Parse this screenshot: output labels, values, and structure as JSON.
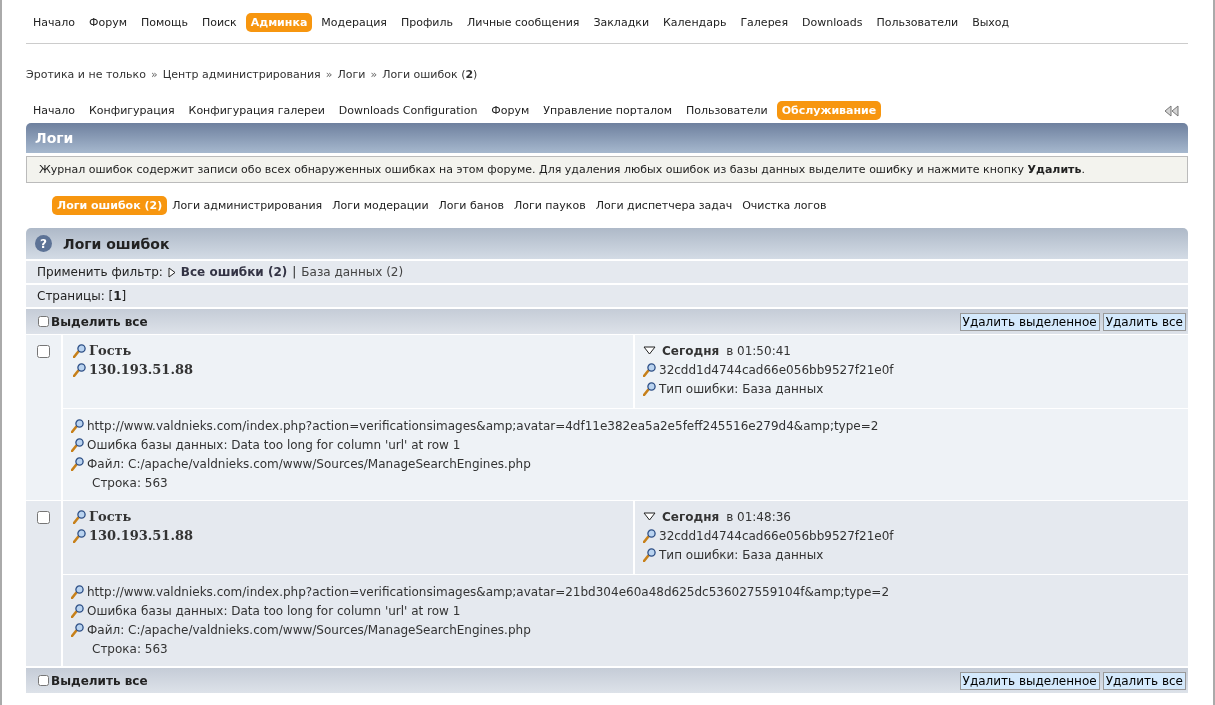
{
  "main_menu": [
    {
      "label": "Начало",
      "selected": false
    },
    {
      "label": "Форум",
      "selected": false
    },
    {
      "label": "Помощь",
      "selected": false
    },
    {
      "label": "Поиск",
      "selected": false
    },
    {
      "label": "Админка",
      "selected": true
    },
    {
      "label": "Модерация",
      "selected": false
    },
    {
      "label": "Профиль",
      "selected": false
    },
    {
      "label": "Личные сообщения",
      "selected": false
    },
    {
      "label": "Закладки",
      "selected": false
    },
    {
      "label": "Календарь",
      "selected": false
    },
    {
      "label": "Галерея",
      "selected": false
    },
    {
      "label": "Downloads",
      "selected": false
    },
    {
      "label": "Пользователи",
      "selected": false
    },
    {
      "label": "Выход",
      "selected": false
    }
  ],
  "breadcrumb": [
    "Эротика и не только",
    "Центр администрирования",
    "Логи",
    "Логи ошибок (**2**)"
  ],
  "breadcrumb_separator": "»",
  "admin_menu": [
    {
      "label": "Начало",
      "selected": false
    },
    {
      "label": "Конфигурация",
      "selected": false
    },
    {
      "label": "Конфигурация галереи",
      "selected": false
    },
    {
      "label": "Downloads Configuration",
      "selected": false
    },
    {
      "label": "Форум",
      "selected": false
    },
    {
      "label": "Управление порталом",
      "selected": false
    },
    {
      "label": "Пользователи",
      "selected": false
    },
    {
      "label": "Обслуживание",
      "selected": true
    }
  ],
  "section_title": "Логи",
  "description": "Журнал ошибок содержит записи обо всех обнаруженных ошибках на этом форуме. Для удаления любых ошибок из базы данных выделите ошибку и нажмите кнопку **Удалить**.",
  "log_tabs": [
    {
      "label": "Логи ошибок (2)",
      "selected": true
    },
    {
      "label": "Логи администрирования",
      "selected": false
    },
    {
      "label": "Логи модерации",
      "selected": false
    },
    {
      "label": "Логи банов",
      "selected": false
    },
    {
      "label": "Логи пауков",
      "selected": false
    },
    {
      "label": "Логи диспетчера задач",
      "selected": false
    },
    {
      "label": "Очистка логов",
      "selected": false
    }
  ],
  "panel": {
    "help": "?",
    "title": "Логи ошибок",
    "filter": {
      "label": "Применить фильтр:",
      "separator": "|",
      "options": [
        {
          "label": "Все ошибки (2)",
          "selected": true
        },
        {
          "label": "База данных (2)",
          "selected": false
        }
      ]
    },
    "pages": "Страницы: [**1**]",
    "top_bar": {
      "select_all": {
        "label": "Выделить все",
        "checked": false
      },
      "buttons": [
        "Удалить выделенное",
        "Удалить все"
      ]
    },
    "entries": [
      {
        "checked": false,
        "member": "Гость",
        "ip": "130.193.51.88",
        "day": "Сегодня",
        "time": "в 01:50:41",
        "session": "32cdd1d4744cad66e056bb9527f21e0f",
        "error_type": "Тип ошибки: База данных",
        "url": "http://www.valdnieks.com/index.php?action=verificationsimages&amp;avatar=4df11e382ea5a2e5feff245516e279d4&amp;type=2",
        "message": "Ошибка базы данных: Data too long for column 'url' at row 1",
        "file": "Файл: C:/apache/valdnieks.com/www/Sources/ManageSearchEngines.php",
        "line": "Строка: 563"
      },
      {
        "checked": false,
        "member": "Гость",
        "ip": "130.193.51.88",
        "day": "Сегодня",
        "time": "в 01:48:36",
        "session": "32cdd1d4744cad66e056bb9527f21e0f",
        "error_type": "Тип ошибки: База данных",
        "url": "http://www.valdnieks.com/index.php?action=verificationsimages&amp;avatar=21bd304e60a48d625dc536027559104f&amp;type=2",
        "message": "Ошибка базы данных: Data too long for column 'url' at row 1",
        "file": "Файл: C:/apache/valdnieks.com/www/Sources/ManageSearchEngines.php",
        "line": "Строка: 563"
      }
    ],
    "bottom_bar": {
      "select_all": {
        "label": "Выделить все",
        "checked": false
      },
      "buttons": [
        "Удалить выделенное",
        "Удалить все"
      ]
    }
  }
}
